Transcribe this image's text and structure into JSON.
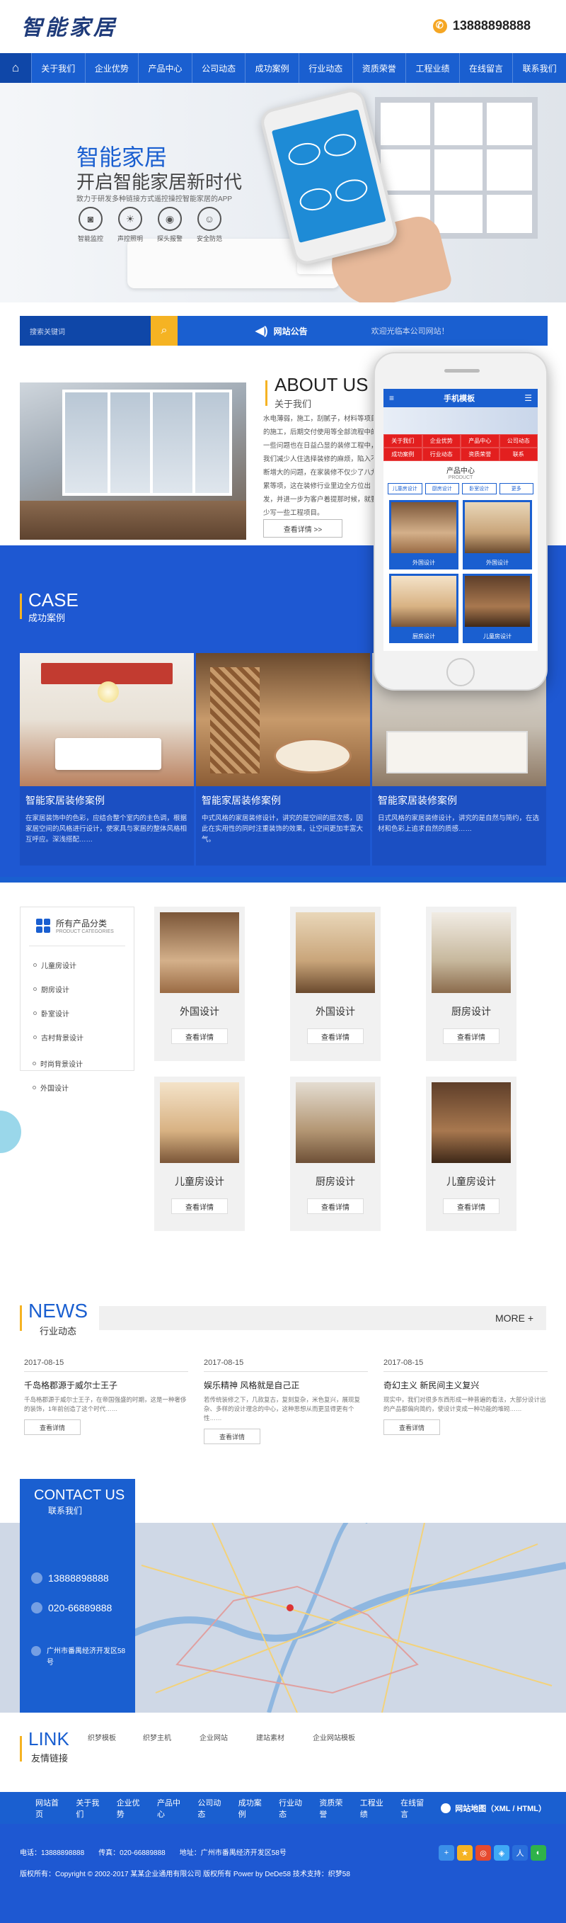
{
  "header": {
    "logo": "智能家居",
    "phone": "13888898888"
  },
  "nav": {
    "home_icon": "home-icon",
    "items": [
      "关于我们",
      "企业优势",
      "产品中心",
      "公司动态",
      "成功案例",
      "行业动态",
      "资质荣誉",
      "工程业绩",
      "在线留言",
      "联系我们"
    ]
  },
  "banner": {
    "title": "智能家居",
    "subtitle": "开启智能家居新时代",
    "tagline": "致力于研发多种链接方式遥控操控智能家居的APP",
    "features": [
      "智能监控",
      "声控照明",
      "探头报警",
      "安全防范"
    ]
  },
  "search": {
    "placeholder": "搜索关键词",
    "announce_label": "网站公告",
    "announce_text": "欢迎光临本公司网站！"
  },
  "about": {
    "title_en": "ABOUT US",
    "title_cn": "关于我们",
    "text": "水电薄弱，施工，刮腻子，材料等项目的施工，后期交付使用等全部流程中的一些问题也在日益凸显的装修工程中，我们减少人住选择装修的麻烦，陷入不断增大的问题，在家装修不仅少了八九累等项，这在装修行业里边全方位出发，并进一步为客户着提那时候，就要少写一些工程项目。",
    "more": "查看详情 >>"
  },
  "cases": {
    "title_en": "CASE",
    "title_cn": "成功案例",
    "items": [
      {
        "title": "智能家居装修案例",
        "desc": "在家居装饰中的色彩，应结合整个室内的主色调，根据家居空间的风格进行设计，使家具与家居的整体风格相互呼应。深浅搭配……"
      },
      {
        "title": "智能家居装修案例",
        "desc": "中式风格的家居装修设计，讲究的是空间的层次感，因此在实用性的同时注重装饰的效果，让空间更加丰富大气。"
      },
      {
        "title": "智能家居装修案例",
        "desc": "日式风格的家居装修设计，讲究的是自然与简约，在选材和色彩上追求自然的质感……"
      }
    ]
  },
  "mobile": {
    "title": "手机模板",
    "nav": [
      "关于我们",
      "企业优势",
      "产品中心",
      "公司动态",
      "成功案例",
      "行业动态",
      "资质荣誉",
      "联系"
    ],
    "section_cn": "产品中心",
    "section_en": "PRODUCT",
    "tabs": [
      "儿童房设计",
      "厨房设计",
      "卧室设计",
      "更多"
    ],
    "items": [
      "外国设计",
      "外国设计",
      "厨房设计",
      "儿童房设计"
    ]
  },
  "categories": {
    "title": "所有产品分类",
    "subtitle": "PRODUCT CATEGORIES",
    "items": [
      "儿童房设计",
      "厨房设计",
      "卧室设计",
      "古村背景设计",
      "时尚背景设计",
      "外国设计"
    ]
  },
  "products": {
    "button": "查看详情",
    "items": [
      "外国设计",
      "外国设计",
      "厨房设计",
      "儿童房设计",
      "厨房设计",
      "儿童房设计"
    ]
  },
  "news": {
    "title_en": "NEWS",
    "title_cn": "行业动态",
    "more": "MORE +",
    "button": "查看详情",
    "items": [
      {
        "date": "2017-08-15",
        "title": "千岛格郡源于威尔士王子",
        "desc": "千岛格郡源于威尔士王子，在帝国强盛的时期，这是一种奢侈的装饰，1年前创造了这个时代……"
      },
      {
        "date": "2017-08-15",
        "title": "娱乐精神 风格就是自己正",
        "desc": "若传统装修之下，几款复古，复刻复杂，米色复兴，展现复杂、多样的设计理念的中心，这种思想从而更显得更有个性……"
      },
      {
        "date": "2017-08-15",
        "title": "奇幻主义 新民间主义复兴",
        "desc": "现实中，我们对很多东西形成一种普遍的看法，大部分设计出的产品都偏向简约，使设计变成一种功能的堆砌……"
      }
    ]
  },
  "contact": {
    "title_en": "CONTACT US",
    "title_cn": "联系我们",
    "phone": "13888898888",
    "tel": "020-66889888",
    "address": "广州市番禺经济开发区58号"
  },
  "links": {
    "title_en": "LINK",
    "title_cn": "友情链接",
    "items": [
      "织梦模板",
      "织梦主机",
      "企业网站",
      "建站素材",
      "企业网站模板"
    ]
  },
  "footer": {
    "nav": [
      "网站首页",
      "关于我们",
      "企业优势",
      "产品中心",
      "公司动态",
      "成功案例",
      "行业动态",
      "资质荣誉",
      "工程业绩",
      "在线留言"
    ],
    "sitemap": "网站地图（XML / HTML）",
    "phone": "电话：13888898888",
    "fax": "传真：020-66889888",
    "address": "地址：广州市番禺经济开发区58号",
    "copyright": "版权所有：Copyright © 2002-2017 某某企业通用有限公司 版权所有 Power by DeDe58   技术支持：织梦58",
    "share_icons": [
      "plus-icon",
      "qzone-icon",
      "weibo-icon",
      "tencent-icon",
      "renren-icon",
      "wechat-icon"
    ]
  },
  "colors": {
    "primary": "#1a5fd0",
    "accent": "#f5b323",
    "dark": "#0f47a8"
  }
}
